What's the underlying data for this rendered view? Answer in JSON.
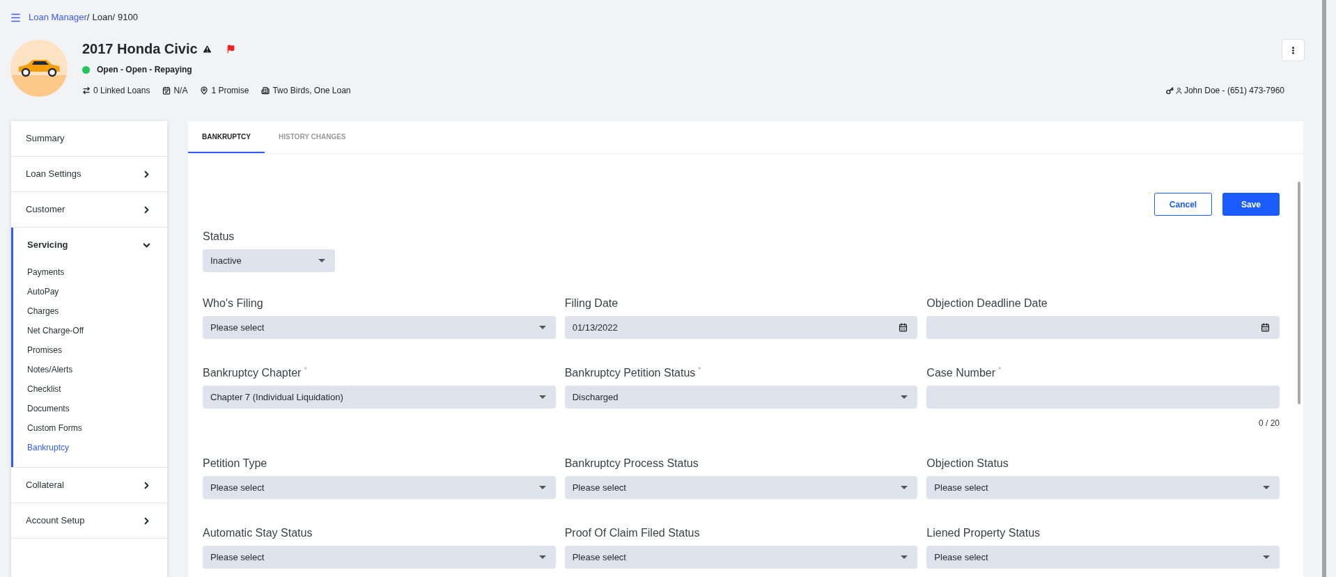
{
  "breadcrumb": [
    {
      "label": "Loan Manager",
      "kind": "link"
    },
    {
      "label": "/",
      "kind": "separator"
    },
    {
      "label": "Loan",
      "kind": "text"
    },
    {
      "label": "/",
      "kind": "separator"
    },
    {
      "label": "9100",
      "kind": "text"
    }
  ],
  "loan": {
    "title": "2017 Honda Civic",
    "status": {
      "text": "Open - Open - Repaying",
      "color": "#22c55e"
    },
    "meta": [
      {
        "kind": "linked",
        "text": "0 Linked Loans"
      },
      {
        "kind": "date",
        "text": "N/A"
      },
      {
        "kind": "promise",
        "text": "1 Promise"
      },
      {
        "kind": "company",
        "text": "Two Birds, One Loan"
      }
    ],
    "contact": "John Doe - (651) 473-7960"
  },
  "sidebar": {
    "items": [
      {
        "label": "Summary",
        "kind": "link",
        "expanded": false
      },
      {
        "label": "Loan Settings",
        "kind": "group",
        "expanded": false
      },
      {
        "label": "Customer",
        "kind": "group",
        "expanded": false
      },
      {
        "label": "Servicing",
        "kind": "group",
        "expanded": true,
        "children": [
          {
            "label": "Payments",
            "selected": false
          },
          {
            "label": "AutoPay",
            "selected": false
          },
          {
            "label": "Charges",
            "selected": false
          },
          {
            "label": "Net Charge-Off",
            "selected": false
          },
          {
            "label": "Promises",
            "selected": false
          },
          {
            "label": "Notes/Alerts",
            "selected": false
          },
          {
            "label": "Checklist",
            "selected": false
          },
          {
            "label": "Documents",
            "selected": false
          },
          {
            "label": "Custom Forms",
            "selected": false
          },
          {
            "label": "Bankruptcy",
            "selected": true
          }
        ]
      },
      {
        "label": "Collateral",
        "kind": "group",
        "expanded": false
      },
      {
        "label": "Account Setup",
        "kind": "group",
        "expanded": false
      }
    ]
  },
  "tabs": [
    {
      "label": "BANKRUPTCY",
      "selected": true
    },
    {
      "label": "HISTORY CHANGES",
      "selected": false
    }
  ],
  "buttons": [
    {
      "label": "Cancel",
      "kind": "outline"
    },
    {
      "label": "Save",
      "kind": "primary"
    }
  ],
  "status_field": {
    "label": "Status",
    "kind": "select",
    "value": "Inactive"
  },
  "fields": [
    {
      "label": "Who's Filing",
      "kind": "select",
      "value": "Please select"
    },
    {
      "label": "Filing Date",
      "kind": "date",
      "value": "01/13/2022"
    },
    {
      "label": "Objection Deadline Date",
      "kind": "date"
    },
    {
      "label": "Bankruptcy Chapter",
      "kind": "select",
      "required_mark": "*",
      "value": "Chapter 7 (Individual Liquidation)"
    },
    {
      "label": "Bankruptcy Petition Status",
      "kind": "select",
      "required_mark": "*",
      "value": "Discharged"
    },
    {
      "label": "Case Number",
      "kind": "text",
      "required_mark": "*",
      "counter": "0 / 20"
    },
    {
      "label": "Petition Type",
      "kind": "select",
      "value": "Please select"
    },
    {
      "label": "Bankruptcy Process Status",
      "kind": "select",
      "value": "Please select"
    },
    {
      "label": "Objection Status",
      "kind": "select",
      "value": "Please select"
    },
    {
      "label": "Automatic Stay Status",
      "kind": "select",
      "value": "Please select"
    },
    {
      "label": "Proof Of Claim Filed Status",
      "kind": "select",
      "value": "Please select"
    },
    {
      "label": "Liened Property Status",
      "kind": "select",
      "value": "Please select"
    }
  ]
}
